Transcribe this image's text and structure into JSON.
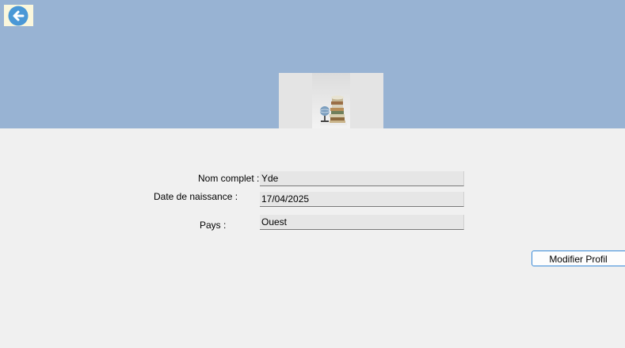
{
  "header": {
    "back_icon": "arrow-left-circle-icon",
    "profile_image": "books-and-globe-photo"
  },
  "form": {
    "name_label": "Nom complet :",
    "name_value": "Yde",
    "birthdate_label": "Date de naissance :",
    "birthdate_value": "17/04/2025",
    "country_label": "Pays  :",
    "country_value": "Ouest"
  },
  "actions": {
    "modify_label": "Modifier Profil"
  },
  "colors": {
    "header_bg": "#98b3d3",
    "back_button_bg": "#fbf7dc",
    "back_icon_color": "#4a98d6",
    "page_bg": "#f0f0f0",
    "field_bg": "#e6e6e6",
    "button_border": "#3a8bd8"
  }
}
